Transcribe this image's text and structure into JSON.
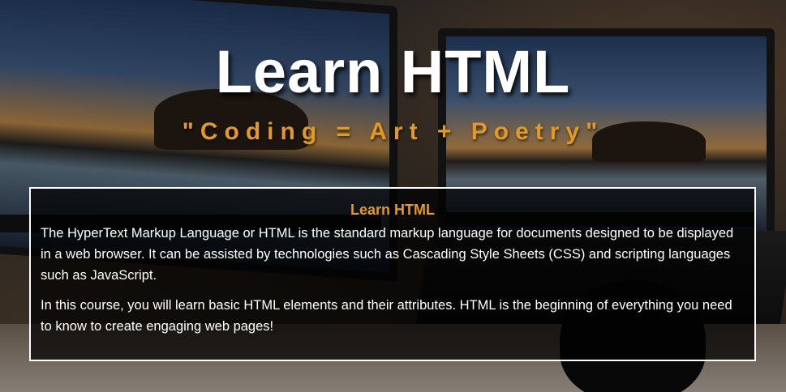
{
  "hero": {
    "title": "Learn HTML",
    "subtitle": "\"Coding = Art + Poetry\""
  },
  "intro_card": {
    "heading": "Learn HTML",
    "paragraphs": [
      "The HyperText Markup Language or HTML is the standard markup language for documents designed to be displayed in a web browser. It can be assisted by technologies such as Cascading Style Sheets (CSS) and scripting languages such as JavaScript.",
      "In this course, you will learn basic HTML elements and their attributes. HTML is the beginning of everything you need to know to create engaging web pages!"
    ]
  },
  "colors": {
    "accent": "#e39a22",
    "text": "#ffffff",
    "card_border": "#ffffff"
  }
}
